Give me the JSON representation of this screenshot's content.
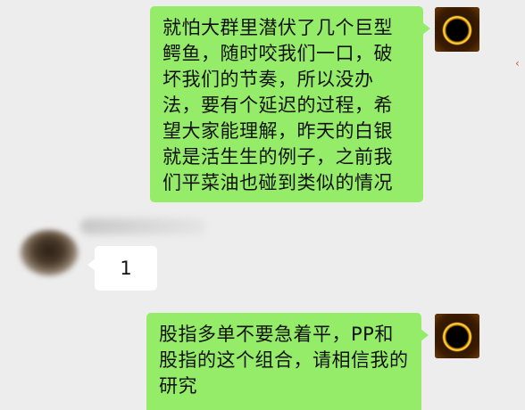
{
  "messages": [
    {
      "side": "right",
      "text": "就怕大群里潜伏了几个巨型鳄鱼，随时咬我们一口，破坏我们的节奏，所以没办法，要有个延迟的过程，希望大家能理解，昨天的白银就是活生生的例子，之前我们平菜油也碰到类似的情况"
    },
    {
      "side": "left",
      "text": "1"
    },
    {
      "side": "right",
      "text": "股指多单不要急着平，PP和股指的这个组合，请相信我的研究"
    }
  ],
  "icons": {
    "self_avatar": "solar-eclipse-avatar-icon",
    "other_avatar": "blurred-avatar"
  },
  "colors": {
    "background": "#ededed",
    "outgoing_bubble": "#95ec69",
    "incoming_bubble": "#ffffff"
  }
}
